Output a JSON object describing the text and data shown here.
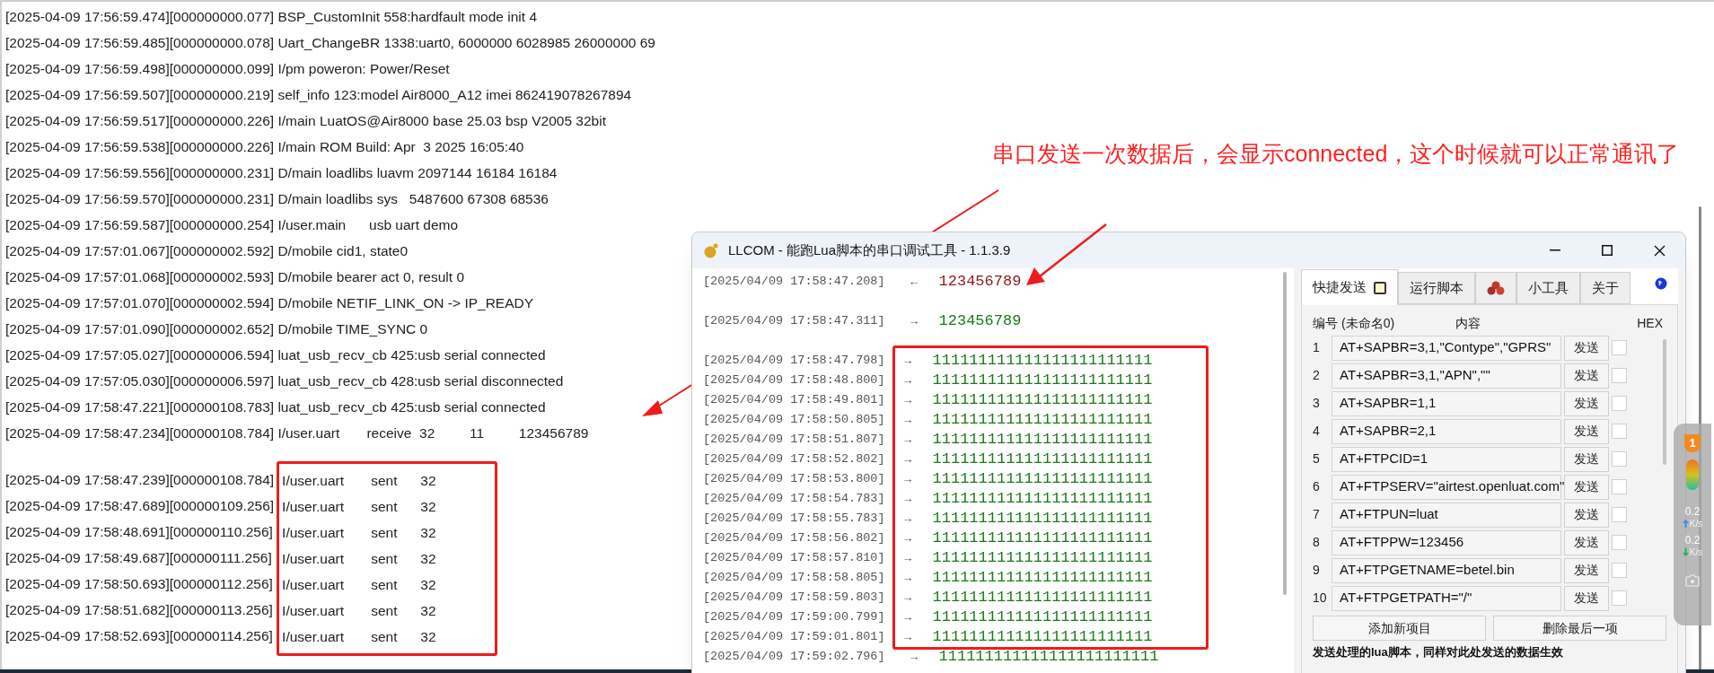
{
  "log_window": {
    "lines": [
      "[2025-04-09 17:56:59.474][000000000.077] BSP_CustomInit 558:hardfault mode init 4",
      "[2025-04-09 17:56:59.485][000000000.078] Uart_ChangeBR 1338:uart0, 6000000 6028985 26000000 69",
      "[2025-04-09 17:56:59.498][000000000.099] I/pm poweron: Power/Reset",
      "[2025-04-09 17:56:59.507][000000000.219] self_info 123:model Air8000_A12 imei 862419078267894",
      "[2025-04-09 17:56:59.517][000000000.226] I/main LuatOS@Air8000 base 25.03 bsp V2005 32bit",
      "[2025-04-09 17:56:59.538][000000000.226] I/main ROM Build: Apr  3 2025 16:05:40",
      "[2025-04-09 17:56:59.556][000000000.231] D/main loadlibs luavm 2097144 16184 16184",
      "[2025-04-09 17:56:59.570][000000000.231] D/main loadlibs sys   5487600 67308 68536",
      "[2025-04-09 17:56:59.587][000000000.254] I/user.main      usb uart demo",
      "[2025-04-09 17:57:01.067][000000002.592] D/mobile cid1, state0",
      "[2025-04-09 17:57:01.068][000000002.593] D/mobile bearer act 0, result 0",
      "[2025-04-09 17:57:01.070][000000002.594] D/mobile NETIF_LINK_ON -> IP_READY",
      "[2025-04-09 17:57:01.090][000000002.652] D/mobile TIME_SYNC 0",
      "[2025-04-09 17:57:05.027][000000006.594] luat_usb_recv_cb 425:usb serial connected",
      "[2025-04-09 17:57:05.030][000000006.597] luat_usb_recv_cb 428:usb serial disconnected",
      "[2025-04-09 17:58:47.221][000000108.783] luat_usb_recv_cb 425:usb serial connected",
      "[2025-04-09 17:58:47.234][000000108.784] I/user.uart       receive  32         11         123456789"
    ],
    "sent_lines": [
      {
        "prefix": "[2025-04-09 17:58:47.239][000000108.784]",
        "message": "I/user.uart       sent      32"
      },
      {
        "prefix": "[2025-04-09 17:58:47.689][000000109.256]",
        "message": "I/user.uart       sent      32"
      },
      {
        "prefix": "[2025-04-09 17:58:48.691][000000110.256]",
        "message": "I/user.uart       sent      32"
      },
      {
        "prefix": "[2025-04-09 17:58:49.687][000000111.256]",
        "message": "I/user.uart       sent      32"
      },
      {
        "prefix": "[2025-04-09 17:58:50.693][000000112.256]",
        "message": "I/user.uart       sent      32"
      },
      {
        "prefix": "[2025-04-09 17:58:51.682][000000113.256]",
        "message": "I/user.uart       sent      32"
      },
      {
        "prefix": "[2025-04-09 17:58:52.693][000000114.256]",
        "message": "I/user.uart       sent      32"
      }
    ]
  },
  "llcom": {
    "title": "LLCOM - 能跑Lua脚本的串口调试工具 - 1.1.3.9",
    "messages": [
      {
        "time": "[2025/04/09 17:58:47.208]",
        "arrow": "←",
        "color": "#8b1a1a",
        "text": "123456789"
      },
      {
        "time": "[2025/04/09 17:58:47.311]",
        "arrow": "→",
        "color": "#1a7a1a",
        "text": "123456789"
      }
    ],
    "burst": [
      {
        "time": "[2025/04/09 17:58:47.798]",
        "arrow": "→",
        "color": "#1a7a1a",
        "text": "111111111111111111111111"
      },
      {
        "time": "[2025/04/09 17:58:48.800]",
        "arrow": "→",
        "color": "#1a7a1a",
        "text": "111111111111111111111111"
      },
      {
        "time": "[2025/04/09 17:58:49.801]",
        "arrow": "→",
        "color": "#1a7a1a",
        "text": "111111111111111111111111"
      },
      {
        "time": "[2025/04/09 17:58:50.805]",
        "arrow": "→",
        "color": "#1a7a1a",
        "text": "111111111111111111111111"
      },
      {
        "time": "[2025/04/09 17:58:51.807]",
        "arrow": "→",
        "color": "#1a7a1a",
        "text": "111111111111111111111111"
      },
      {
        "time": "[2025/04/09 17:58:52.802]",
        "arrow": "→",
        "color": "#1a7a1a",
        "text": "111111111111111111111111"
      },
      {
        "time": "[2025/04/09 17:58:53.800]",
        "arrow": "→",
        "color": "#1a7a1a",
        "text": "111111111111111111111111"
      },
      {
        "time": "[2025/04/09 17:58:54.783]",
        "arrow": "→",
        "color": "#1a7a1a",
        "text": "111111111111111111111111"
      },
      {
        "time": "[2025/04/09 17:58:55.783]",
        "arrow": "→",
        "color": "#1a7a1a",
        "text": "111111111111111111111111"
      },
      {
        "time": "[2025/04/09 17:58:56.802]",
        "arrow": "→",
        "color": "#1a7a1a",
        "text": "111111111111111111111111"
      },
      {
        "time": "[2025/04/09 17:58:57.810]",
        "arrow": "→",
        "color": "#1a7a1a",
        "text": "111111111111111111111111"
      },
      {
        "time": "[2025/04/09 17:58:58.805]",
        "arrow": "→",
        "color": "#1a7a1a",
        "text": "111111111111111111111111"
      },
      {
        "time": "[2025/04/09 17:58:59.803]",
        "arrow": "→",
        "color": "#1a7a1a",
        "text": "111111111111111111111111"
      },
      {
        "time": "[2025/04/09 17:59:00.799]",
        "arrow": "→",
        "color": "#1a7a1a",
        "text": "111111111111111111111111"
      },
      {
        "time": "[2025/04/09 17:59:01.801]",
        "arrow": "→",
        "color": "#1a7a1a",
        "text": "111111111111111111111111"
      }
    ],
    "after_burst": [
      {
        "time": "[2025/04/09 17:59:02.796]",
        "arrow": "→",
        "color": "#1a7a1a",
        "text": "111111111111111111111111"
      }
    ],
    "tabs": [
      {
        "kind": "text",
        "label": "快捷发送",
        "selected": true
      },
      {
        "kind": "text",
        "label": "运行脚本",
        "selected": false
      },
      {
        "kind": "icon",
        "selected": false
      },
      {
        "kind": "text",
        "label": "小工具",
        "selected": false
      },
      {
        "kind": "text",
        "label": "关于",
        "selected": false
      }
    ],
    "quick_send": {
      "header_number": "编号",
      "header_name": "(未命名0)",
      "header_content": "内容",
      "header_hex": "HEX",
      "items": [
        {
          "number": "1",
          "command": "AT+SAPBR=3,1,\"Contype\",\"GPRS\"",
          "button": "发送",
          "hex": false
        },
        {
          "number": "2",
          "command": "AT+SAPBR=3,1,\"APN\",\"\"",
          "button": "发送",
          "hex": false
        },
        {
          "number": "3",
          "command": "AT+SAPBR=1,1",
          "button": "发送",
          "hex": false
        },
        {
          "number": "4",
          "command": "AT+SAPBR=2,1",
          "button": "发送",
          "hex": false
        },
        {
          "number": "5",
          "command": "AT+FTPCID=1",
          "button": "发送",
          "hex": false
        },
        {
          "number": "6",
          "command": "AT+FTPSERV=\"airtest.openluat.com\"",
          "button": "发送",
          "hex": false
        },
        {
          "number": "7",
          "command": "AT+FTPUN=luat",
          "button": "发送",
          "hex": false
        },
        {
          "number": "8",
          "command": "AT+FTPPW=123456",
          "button": "发送",
          "hex": false
        },
        {
          "number": "9",
          "command": "AT+FTPGETNAME=betel.bin",
          "button": "发送",
          "hex": false
        },
        {
          "number": "10",
          "command": "AT+FTPGETPATH=\"/\"",
          "button": "发送",
          "hex": false
        }
      ],
      "add_button": "添加新项目",
      "delete_button": "删除最后一项",
      "script_note": "发送处理的lua脚本，同样对此处发送的数据生效"
    }
  },
  "monitor_widget": {
    "badge": "1",
    "upload": "0.2",
    "upload_unit": "K/s",
    "download": "0.2",
    "download_unit": "K/s"
  },
  "annotation": {
    "text": "串口发送一次数据后，会显示connected，这个时候就可以正常通讯了"
  }
}
